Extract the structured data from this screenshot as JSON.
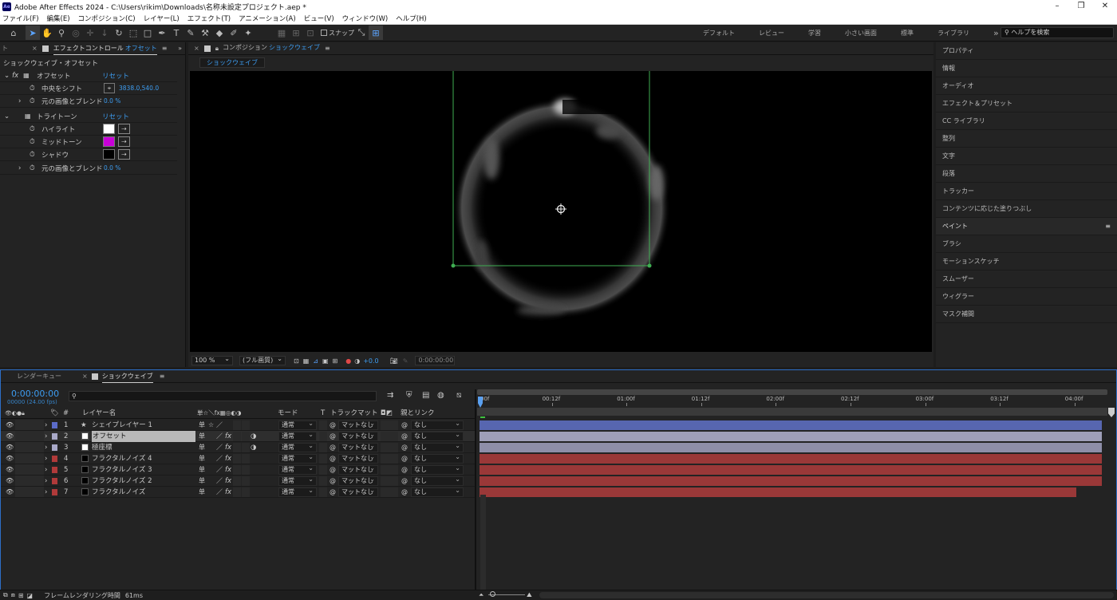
{
  "app": {
    "logo": "Ae",
    "title": "Adobe After Effects 2024 - C:\\Users\\rikim\\Downloads\\名称未設定プロジェクト.aep *",
    "window_buttons": [
      "–",
      "❐",
      "✕"
    ]
  },
  "menu": [
    "ファイル(F)",
    "編集(E)",
    "コンポジション(C)",
    "レイヤー(L)",
    "エフェクト(T)",
    "アニメーション(A)",
    "ビュー(V)",
    "ウィンドウ(W)",
    "ヘルプ(H)"
  ],
  "toolbar": {
    "snap_label": "スナップ",
    "workspaces": [
      "デフォルト",
      "レビュー",
      "学習",
      "小さい画面",
      "標準",
      "ライブラリ"
    ],
    "more": "»",
    "help_placeholder": "ヘルプを検索"
  },
  "effects_panel": {
    "prev_tab": "ト",
    "tab_label": "エフェクトコントロール",
    "tab_target": "オフセット",
    "header": "ショックウェイブ・オフセット",
    "fx_symbol": "fx",
    "reset": "リセット",
    "effects": [
      {
        "name": "オフセット",
        "props": [
          {
            "label": "中央をシフト",
            "value": "3838.0,540.0"
          },
          {
            "label": "元の画像とブレンド",
            "value": "0.0 %"
          }
        ]
      },
      {
        "name": "トライトーン",
        "props": [
          {
            "label": "ハイライト",
            "color": "#ffffff"
          },
          {
            "label": "ミッドトーン",
            "color": "#c800d8"
          },
          {
            "label": "シャドウ",
            "color": "#000000"
          },
          {
            "label": "元の画像とブレンド",
            "value": "0.0 %"
          }
        ]
      }
    ]
  },
  "composition_panel": {
    "tab_prefix": "コンポジション",
    "tab_name": "ショックウェイブ",
    "subtab": "ショックウェイブ",
    "zoom": "100 %",
    "resolution": "(フル画質)",
    "exposure": "+0.0",
    "timecode": "0:00:00:00"
  },
  "right_panel": {
    "items": [
      "プロパティ",
      "情報",
      "オーディオ",
      "エフェクト＆プリセット",
      "CC ライブラリ",
      "整列",
      "文字",
      "段落",
      "トラッカー",
      "コンテンツに応じた塗りつぶし"
    ],
    "paint_header": "ペイント",
    "paint_items": [
      "ブラシ",
      "モーションスケッチ",
      "スムーザー",
      "ウィグラー",
      "マスク補間"
    ]
  },
  "timeline": {
    "tabs": [
      "レンダーキュー",
      "ショックウェイブ"
    ],
    "timecode": "0:00:00:00",
    "fps": "00000 (24.00 fps)",
    "search_placeholder": "",
    "headers": {
      "num": "#",
      "layer_name": "レイヤー名",
      "switches": "単☆＼fx▦◎◐◑",
      "mode": "モード",
      "t": "T",
      "track_matte": "トラックマット",
      "parent": "親とリンク"
    },
    "ruler": [
      "00f",
      "00:12f",
      "01:00f",
      "01:12f",
      "02:00f",
      "02:12f",
      "03:00f",
      "03:12f",
      "04:00f"
    ],
    "layers": [
      {
        "num": "1",
        "name": "シェイプレイヤー 1",
        "color": "#5b6bc8",
        "icon": "★",
        "mode": "通常",
        "matte": "マットなし",
        "parent": "なし",
        "bar": "#5766b0",
        "fx": false
      },
      {
        "num": "2",
        "name": "オフセット",
        "color": "#a9a9c8",
        "icon": "",
        "mode": "通常",
        "matte": "マットなし",
        "parent": "なし",
        "bar": "#9e9eb8",
        "fx": true
      },
      {
        "num": "3",
        "name": "極座標",
        "color": "#a9a9c8",
        "icon": "",
        "mode": "通常",
        "matte": "マットなし",
        "parent": "なし",
        "bar": "#8e8ea8",
        "fx": true
      },
      {
        "num": "4",
        "name": "フラクタルノイズ 4",
        "color": "#b03a3a",
        "icon": "",
        "mode": "通常",
        "matte": "マットなし",
        "parent": "なし",
        "bar": "#9a3838",
        "fx": true
      },
      {
        "num": "5",
        "name": "フラクタルノイズ 3",
        "color": "#b03a3a",
        "icon": "",
        "mode": "通常",
        "matte": "マットなし",
        "parent": "なし",
        "bar": "#9a3838",
        "fx": true
      },
      {
        "num": "6",
        "name": "フラクタルノイズ 2",
        "color": "#b03a3a",
        "icon": "",
        "mode": "通常",
        "matte": "マットなし",
        "parent": "なし",
        "bar": "#9a3838",
        "fx": true
      },
      {
        "num": "7",
        "name": "フラクタルノイズ",
        "color": "#b03a3a",
        "icon": "",
        "mode": "通常",
        "matte": "マットなし",
        "parent": "なし",
        "bar": "#9a3838",
        "fx": true
      }
    ],
    "status_label": "フレームレンダリング時間",
    "status_value": "61ms"
  }
}
